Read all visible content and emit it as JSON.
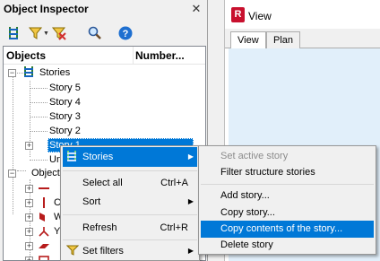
{
  "inspector": {
    "title": "Object Inspector",
    "close": "✕",
    "columns": {
      "objects": "Objects",
      "number": "Number..."
    }
  },
  "tree": {
    "stories_label": "Stories",
    "stories": [
      "Story 5",
      "Story 4",
      "Story 3",
      "Story 2",
      "Story 1"
    ],
    "unassigned": "Un",
    "objects_label": "Objects",
    "object_types": [
      "",
      "C",
      "W",
      "Y",
      "",
      ""
    ]
  },
  "view": {
    "logo": "R",
    "title": "View",
    "tabs": [
      "View",
      "Plan"
    ]
  },
  "context_menu": {
    "stories": "Stories",
    "select_all": "Select all",
    "select_all_shortcut": "Ctrl+A",
    "sort": "Sort",
    "refresh": "Refresh",
    "refresh_shortcut": "Ctrl+R",
    "set_filters": "Set filters"
  },
  "submenu": {
    "set_active": "Set active story",
    "filter": "Filter structure stories",
    "add": "Add story...",
    "copy": "Copy story...",
    "copy_contents": "Copy contents of the story...",
    "delete": "Delete story"
  },
  "colors": {
    "accent": "#0078d7",
    "canvas": "#e1effa",
    "logo": "#c8102e"
  }
}
